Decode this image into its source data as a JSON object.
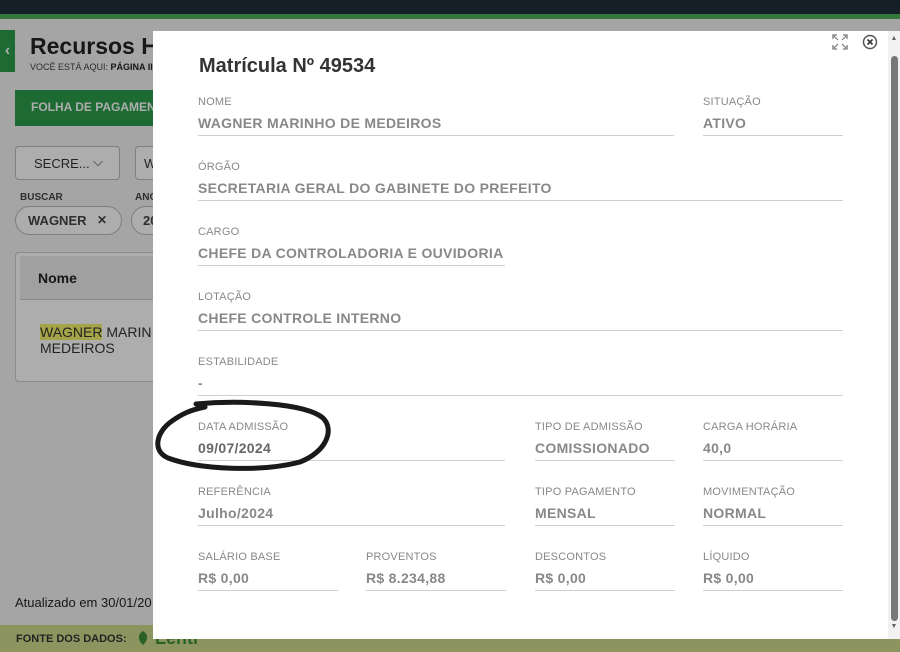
{
  "background": {
    "title": "Recursos H",
    "breadcrumb_prefix": "VOCÊ ESTÁ AQUI:",
    "breadcrumb_page": "PÁGINA II",
    "active_tab": "FOLHA DE PAGAMEN",
    "filter_select": "SECRE...",
    "filter_select_2": "W",
    "search_label": "BUSCAR",
    "year_label": "ANO",
    "chip_search": "WAGNER",
    "chip_year": "20",
    "table_header": "Nome",
    "row_name_highlight": "WAGNER",
    "row_name_rest": " MARIN",
    "row_name_line2": "MEDEIROS",
    "updated": "Atualizado em 30/01/20",
    "footer_label": "FONTE DOS DADOS:",
    "footer_logo": "Lenti"
  },
  "modal": {
    "title": "Matrícula Nº 49534",
    "fields": {
      "nome": {
        "label": "NOME",
        "value": "WAGNER MARINHO DE MEDEIROS"
      },
      "situacao": {
        "label": "SITUAÇÃO",
        "value": "ATIVO"
      },
      "orgao": {
        "label": "ÓRGÃO",
        "value": "SECRETARIA GERAL DO GABINETE DO PREFEITO"
      },
      "cargo": {
        "label": "CARGO",
        "value": "CHEFE DA CONTROLADORIA E OUVIDORIA"
      },
      "lotacao": {
        "label": "LOTAÇÃO",
        "value": "CHEFE CONTROLE INTERNO"
      },
      "estabilidade": {
        "label": "ESTABILIDADE",
        "value": "-"
      },
      "data_admissao": {
        "label": "DATA ADMISSÃO",
        "value": "09/07/2024"
      },
      "tipo_admissao": {
        "label": "TIPO DE ADMISSÃO",
        "value": "COMISSIONADO"
      },
      "carga_horaria": {
        "label": "CARGA HORÁRIA",
        "value": "40,0"
      },
      "referencia": {
        "label": "REFERÊNCIA",
        "value": "Julho/2024"
      },
      "tipo_pagamento": {
        "label": "TIPO PAGAMENTO",
        "value": "MENSAL"
      },
      "movimentacao": {
        "label": "MOVIMENTAÇÃO",
        "value": "NORMAL"
      },
      "salario_base": {
        "label": "SALÁRIO BASE",
        "value": "R$ 0,00"
      },
      "proventos": {
        "label": "PROVENTOS",
        "value": "R$ 8.234,88"
      },
      "descontos": {
        "label": "DESCONTOS",
        "value": "R$ 0,00"
      },
      "liquido": {
        "label": "LÍQUIDO",
        "value": "R$ 0,00"
      }
    }
  },
  "icons": {
    "expand": "expand-icon",
    "close": "close-icon",
    "back": "chevron-left-icon"
  },
  "colors": {
    "brand_green": "#2c9e4b",
    "topbar": "#1e2f3a",
    "footer": "#cfdc8e",
    "highlight": "#f5f26a",
    "field_text": "#888888"
  }
}
